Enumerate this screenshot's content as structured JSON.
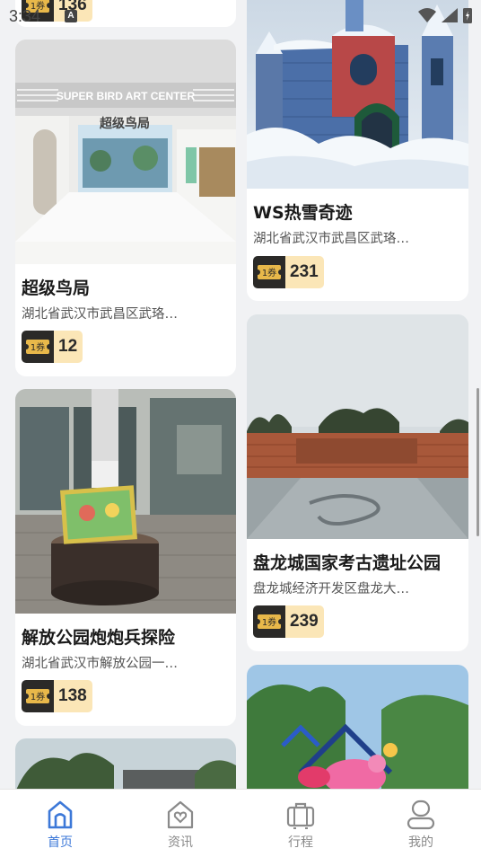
{
  "status_bar": {
    "time": "3:34",
    "badge": "A"
  },
  "cards": [
    {
      "title": "",
      "address": "",
      "tickets": "136"
    },
    {
      "title": "WS热雪奇迹",
      "address": "湖北省武汉市武昌区武珞…",
      "tickets": "231"
    },
    {
      "title": "超级鸟局",
      "address": "湖北省武汉市武昌区武珞…",
      "tickets": "12",
      "image_sign_text": "SUPER BIRD ART CENTER",
      "image_logo_text": "超级鸟局"
    },
    {
      "title": "盘龙城国家考古遗址公园",
      "address": "盘龙城经济开发区盘龙大…",
      "tickets": "239"
    },
    {
      "title": "解放公园炮炮兵探险",
      "address": "湖北省武汉市解放公园一…",
      "tickets": "138"
    },
    {
      "title": "",
      "address": "",
      "tickets": ""
    },
    {
      "title": "",
      "address": "",
      "tickets": ""
    }
  ],
  "ticket_badge_text": "1券",
  "bottom_nav": [
    {
      "label": "首页",
      "icon": "home-icon",
      "active": true
    },
    {
      "label": "资讯",
      "icon": "news-icon",
      "active": false
    },
    {
      "label": "行程",
      "icon": "itinerary-icon",
      "active": false
    },
    {
      "label": "我的",
      "icon": "profile-icon",
      "active": false
    }
  ],
  "colors": {
    "accent": "#3c78d8",
    "ticket_bg": "#fbe6b7",
    "ticket_icon_bg": "#2b2a28",
    "page_bg": "#f1f2f4"
  }
}
